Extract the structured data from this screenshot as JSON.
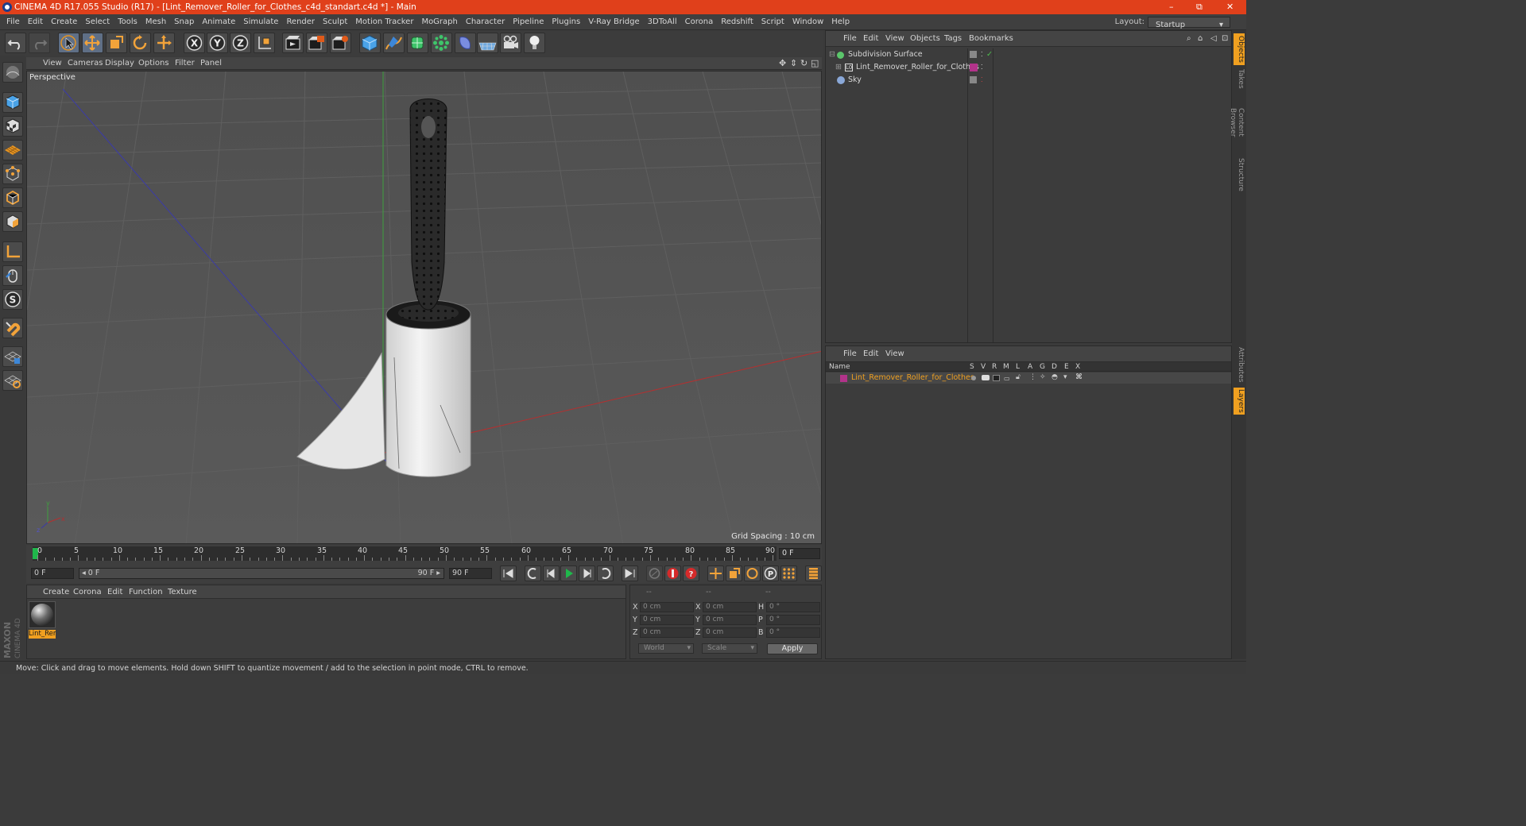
{
  "window": {
    "title": "CINEMA 4D R17.055 Studio (R17) - [Lint_Remover_Roller_for_Clothes_c4d_standart.c4d *] - Main",
    "minimize": "–",
    "maximize": "⧉",
    "close": "✕"
  },
  "menu": [
    "File",
    "Edit",
    "Create",
    "Select",
    "Tools",
    "Mesh",
    "Snap",
    "Animate",
    "Simulate",
    "Render",
    "Sculpt",
    "Motion Tracker",
    "MoGraph",
    "Character",
    "Pipeline",
    "Plugins",
    "V-Ray Bridge",
    "3DToAll",
    "Corona",
    "Redshift",
    "Script",
    "Window",
    "Help"
  ],
  "layout": {
    "label": "Layout:",
    "value": "Startup"
  },
  "toolbar_icons": [
    "undo-icon",
    "redo-icon",
    "select-arrow-icon",
    "move-icon",
    "scale-icon",
    "rotate-icon",
    "move-axis-icon",
    "x-axis-icon",
    "y-axis-icon",
    "z-axis-icon",
    "coordinate-system-icon",
    "render-view-icon",
    "render-picture-viewer-icon",
    "edit-render-settings-icon",
    "cube-primitive-icon",
    "pen-spline-icon",
    "subdivision-nurbs-icon",
    "array-icon",
    "deformer-icon",
    "floor-environment-icon",
    "camera-icon",
    "light-icon"
  ],
  "left_tool_icons": [
    "make-editable-icon",
    "model-mode-icon",
    "texture-mode-icon",
    "workplane-icon",
    "points-mode-icon",
    "edges-mode-icon",
    "polygons-mode-icon",
    "axis-mode-icon",
    "tweak-mode-icon",
    "soft-selection-icon",
    "snap-magnet-icon",
    "grid-lock-icon",
    "grid-rotate-icon"
  ],
  "viewport": {
    "menu": [
      "View",
      "Cameras",
      "Display",
      "Options",
      "Filter",
      "Panel"
    ],
    "camera_label": "Perspective",
    "grid_spacing": "Grid Spacing : 10 cm",
    "axis_labels": {
      "x": "x",
      "y": "y",
      "z": "z"
    }
  },
  "timeline": {
    "ticks": [
      "0",
      "5",
      "10",
      "15",
      "20",
      "25",
      "30",
      "35",
      "40",
      "45",
      "50",
      "55",
      "60",
      "65",
      "70",
      "75",
      "80",
      "85",
      "90"
    ],
    "current_frame": "0 F",
    "start_field": "0 F",
    "slider_start": "◂ 0 F",
    "slider_end": "90 F ▸",
    "end_field": "90 F"
  },
  "material_manager": {
    "menu": [
      "Create",
      "Corona",
      "Edit",
      "Function",
      "Texture"
    ],
    "material_name": "Lint_Rem"
  },
  "coordinates": {
    "header": [
      "--",
      "--",
      "--"
    ],
    "rows": [
      {
        "l1": "X",
        "v1": "0 cm",
        "l2": "X",
        "v2": "0 cm",
        "l3": "H",
        "v3": "0 °"
      },
      {
        "l1": "Y",
        "v1": "0 cm",
        "l2": "Y",
        "v2": "0 cm",
        "l3": "P",
        "v3": "0 °"
      },
      {
        "l1": "Z",
        "v1": "0 cm",
        "l2": "Z",
        "v2": "0 cm",
        "l3": "B",
        "v3": "0 °"
      }
    ],
    "mode": "World",
    "type": "Scale",
    "apply": "Apply"
  },
  "object_manager": {
    "menu": [
      "File",
      "Edit",
      "View",
      "Objects",
      "Tags",
      "Bookmarks"
    ],
    "objects": [
      {
        "name": "Subdivision Surface",
        "color": "#5bc66b"
      },
      {
        "name": "Lint_Remover_Roller_for_Clothes",
        "color": "#b2338a"
      },
      {
        "name": "Sky",
        "color": "#8aa8d8"
      }
    ]
  },
  "layer_manager": {
    "menu": [
      "File",
      "Edit",
      "View"
    ],
    "columns": [
      "Name",
      "S",
      "V",
      "R",
      "M",
      "L",
      "A",
      "G",
      "D",
      "E",
      "X"
    ],
    "layer_name": "Lint_Remover_Roller_for_Clothes",
    "layer_color": "#b2338a"
  },
  "right_tabs": [
    "Objects",
    "Takes",
    "Content Browser",
    "Structure",
    "Attributes",
    "Layers"
  ],
  "status": "Move: Click and drag to move elements. Hold down SHIFT to quantize movement / add to the selection in point mode, CTRL to remove.",
  "brand": {
    "line1": "MAXON",
    "line2": "CINEMA 4D"
  },
  "colors": {
    "title_bar": "#e0401b",
    "active_tab": "#f0a020",
    "playhead": "#1fb84b"
  }
}
